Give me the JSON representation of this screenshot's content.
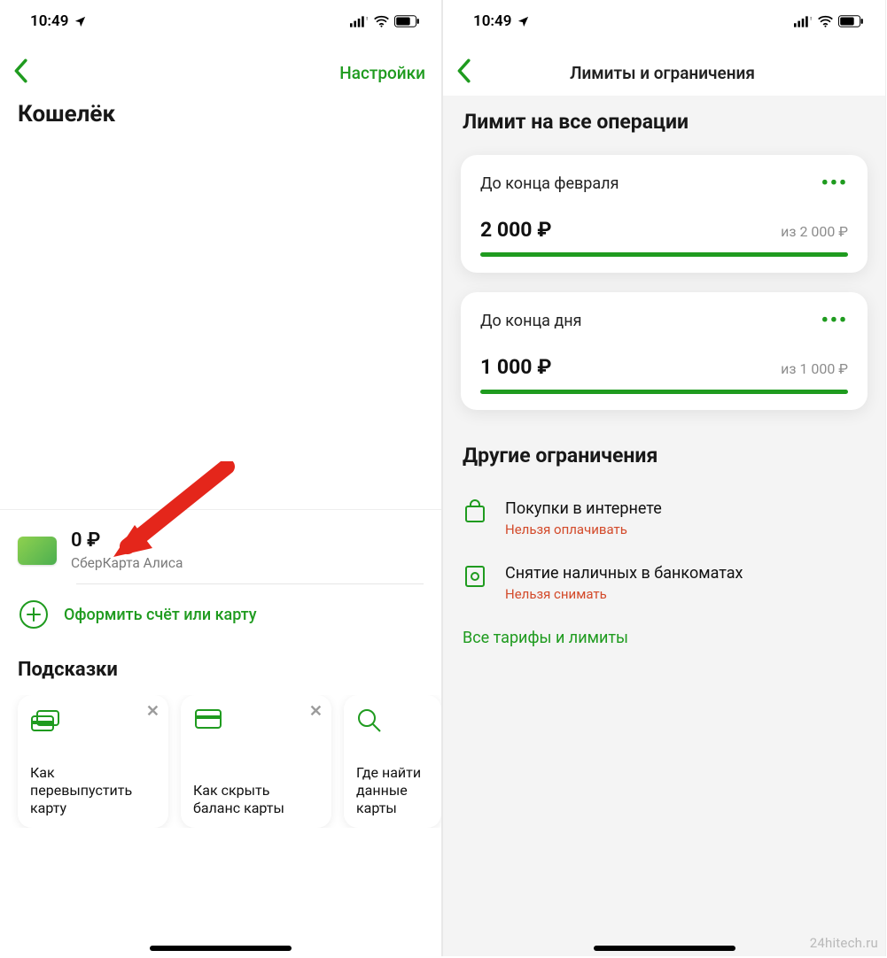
{
  "status": {
    "time": "10:49"
  },
  "left": {
    "settings_label": "Настройки",
    "wallet_title": "Кошелёк",
    "balance": "0 ₽",
    "card_name": "СберКарта Алиса",
    "add_account": "Оформить счёт или карту",
    "hints_title": "Подсказки",
    "hints": [
      {
        "text": "Как перевыпустить карту"
      },
      {
        "text": "Как скрыть баланс карты"
      },
      {
        "text": "Где найти данные карты"
      }
    ]
  },
  "right": {
    "header_title": "Лимиты и ограничения",
    "section_title": "Лимит на все операции",
    "limits": [
      {
        "period": "До конца февраля",
        "amount": "2 000 ₽",
        "of": "из 2 000 ₽"
      },
      {
        "period": "До конца дня",
        "amount": "1 000 ₽",
        "of": "из 1 000 ₽"
      }
    ],
    "other_title": "Другие ограничения",
    "other": [
      {
        "title": "Покупки в интернете",
        "sub": "Нельзя оплачивать"
      },
      {
        "title": "Снятие наличных в банкоматах",
        "sub": "Нельзя снимать"
      }
    ],
    "all_link": "Все тарифы и лимиты"
  },
  "watermark": "24hitech.ru"
}
